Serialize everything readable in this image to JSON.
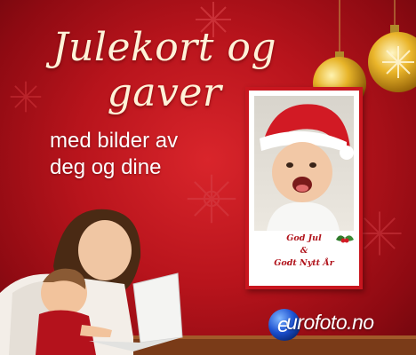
{
  "banner": {
    "title": "Julekort og gaver",
    "subtitle_line1": "med bilder av",
    "subtitle_line2": "deg og dine"
  },
  "card": {
    "greeting_line1": "God Jul",
    "greeting_line2": "&",
    "greeting_line3": "Godt Nytt År",
    "border_color": "#c8161f"
  },
  "brand": {
    "logo_text": "urofoto.no",
    "logo_letter": "e"
  },
  "colors": {
    "background": "#b8141c",
    "title": "#fff2d8",
    "ornament_gold": "#e7b429"
  }
}
